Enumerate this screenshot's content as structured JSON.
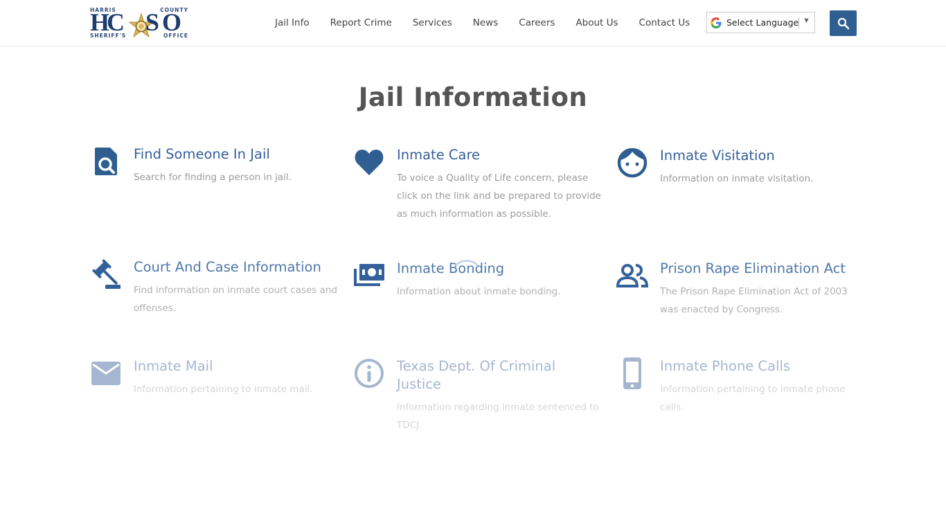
{
  "logo": {
    "top_line": [
      "HARRIS",
      "COUNTY"
    ],
    "letters": "HCSO",
    "bottom_line": [
      "SHERIFF'S",
      "OFFICE"
    ]
  },
  "nav": {
    "items": [
      {
        "label": "Jail Info"
      },
      {
        "label": "Report Crime"
      },
      {
        "label": "Services"
      },
      {
        "label": "News"
      },
      {
        "label": "Careers"
      },
      {
        "label": "About Us"
      },
      {
        "label": "Contact Us"
      }
    ]
  },
  "language": {
    "label": "Select Language"
  },
  "search": {
    "icon": "search-icon"
  },
  "page": {
    "title": "Jail Information"
  },
  "colors": {
    "accent": "#2f5f91",
    "heading": "#34609a",
    "title": "#555555"
  },
  "cards": [
    {
      "title": "Find Someone In Jail",
      "desc": "Search for finding a person in jail.",
      "icon": "search-document-icon"
    },
    {
      "title": "Inmate Care",
      "desc": "To voice a Quality of Life concern, please click on the link and be prepared to provide as much information as possible.",
      "icon": "heart-icon"
    },
    {
      "title": "Inmate Visitation",
      "desc": "Information on inmate visitation.",
      "icon": "face-icon"
    },
    {
      "title": "Court And Case Information",
      "desc": "Find information on inmate court cases and offenses.",
      "icon": "gavel-icon"
    },
    {
      "title": "Inmate Bonding",
      "desc": "Information about inmate bonding.",
      "icon": "money-icon"
    },
    {
      "title": "Prison Rape Elimination Act",
      "desc": "The Prison Rape Elimination Act of 2003 was enacted by Congress.",
      "icon": "people-icon"
    },
    {
      "title": "Inmate Mail",
      "desc": "Information pertaining to inmate mail.",
      "icon": "mail-icon"
    },
    {
      "title": "Texas Dept. Of Criminal Justice",
      "desc": "Information regarding inmate sentenced to TDCJ.",
      "icon": "info-icon"
    },
    {
      "title": "Inmate Phone Calls",
      "desc": "Information pertaining to inmate phone calls.",
      "icon": "phone-icon"
    }
  ]
}
